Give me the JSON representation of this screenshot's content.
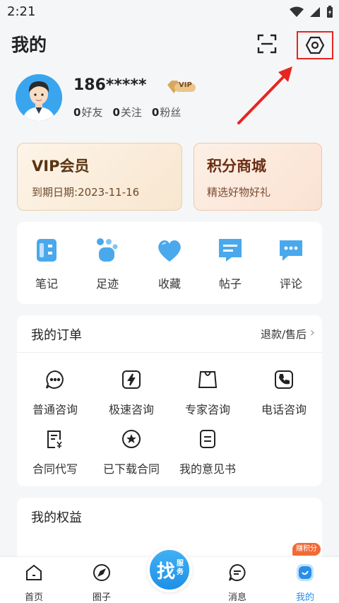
{
  "status_bar": {
    "time": "2:21"
  },
  "header": {
    "title": "我的"
  },
  "profile": {
    "username": "186*****",
    "vip_badge": "VIP",
    "stats": [
      {
        "count": "0",
        "label": "好友"
      },
      {
        "count": "0",
        "label": "关注"
      },
      {
        "count": "0",
        "label": "粉丝"
      }
    ]
  },
  "vip_card": {
    "title": "VIP会员",
    "subtitle": "到期日期:2023-11-16"
  },
  "mall_card": {
    "title": "积分商城",
    "subtitle": "精选好物好礼"
  },
  "quick_links": [
    {
      "label": "笔记",
      "icon": "notes-icon"
    },
    {
      "label": "足迹",
      "icon": "footprint-icon"
    },
    {
      "label": "收藏",
      "icon": "heart-icon"
    },
    {
      "label": "帖子",
      "icon": "post-icon"
    },
    {
      "label": "评论",
      "icon": "comment-icon"
    }
  ],
  "orders": {
    "title": "我的订单",
    "link": "退款/售后",
    "items": [
      {
        "label": "普通咨询",
        "icon": "chat-icon"
      },
      {
        "label": "极速咨询",
        "icon": "lightning-icon"
      },
      {
        "label": "专家咨询",
        "icon": "expert-icon"
      },
      {
        "label": "电话咨询",
        "icon": "phone-icon"
      },
      {
        "label": "合同代写",
        "icon": "contract-icon"
      },
      {
        "label": "已下载合同",
        "icon": "star-icon"
      },
      {
        "label": "我的意见书",
        "icon": "document-icon"
      }
    ]
  },
  "benefits": {
    "title": "我的权益",
    "earn_badge": "赚积分"
  },
  "bottom_nav": {
    "items": [
      {
        "label": "首页",
        "icon": "home-icon"
      },
      {
        "label": "圈子",
        "icon": "compass-icon"
      },
      {
        "label": "消息",
        "icon": "message-icon"
      },
      {
        "label": "我的",
        "icon": "profile-icon"
      }
    ],
    "center_main": "找",
    "center_sub": "服务"
  },
  "colors": {
    "accent": "#2a8ee8",
    "highlight": "#e8251f",
    "vip_text": "#5a3412"
  }
}
